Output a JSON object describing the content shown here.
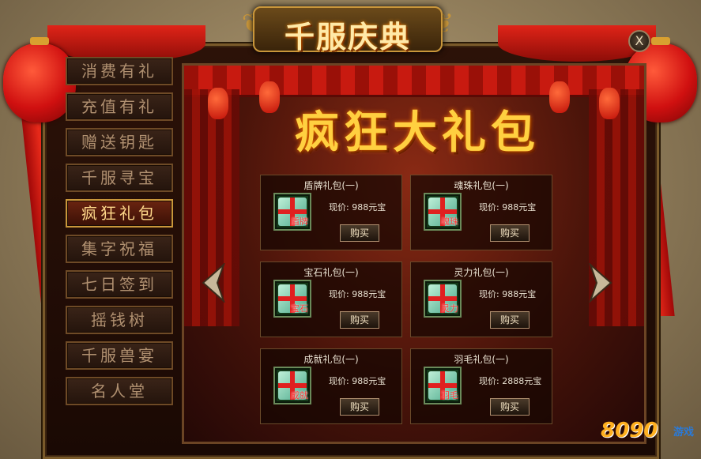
{
  "window": {
    "title": "千服庆典",
    "close_label": "X"
  },
  "sidebar": {
    "items": [
      {
        "label": "消费有礼",
        "active": false
      },
      {
        "label": "充值有礼",
        "active": false
      },
      {
        "label": "赠送钥匙",
        "active": false
      },
      {
        "label": "千服寻宝",
        "active": false
      },
      {
        "label": "疯狂礼包",
        "active": true
      },
      {
        "label": "集字祝福",
        "active": false
      },
      {
        "label": "七日签到",
        "active": false
      },
      {
        "label": "摇钱树",
        "active": false
      },
      {
        "label": "千服兽宴",
        "active": false
      },
      {
        "label": "名人堂",
        "active": false
      }
    ]
  },
  "main": {
    "banner": "疯狂大礼包",
    "packs": [
      {
        "name": "盾牌礼包(一)",
        "tag": "盾牌",
        "price": "现价: 988元宝",
        "buy": "购买"
      },
      {
        "name": "魂珠礼包(一)",
        "tag": "魂珠",
        "price": "现价: 988元宝",
        "buy": "购买"
      },
      {
        "name": "宝石礼包(一)",
        "tag": "宝石",
        "price": "现价: 988元宝",
        "buy": "购买"
      },
      {
        "name": "灵力礼包(一)",
        "tag": "灵力",
        "price": "现价: 988元宝",
        "buy": "购买"
      },
      {
        "name": "成就礼包(一)",
        "tag": "成就",
        "price": "现价: 988元宝",
        "buy": "购买"
      },
      {
        "name": "羽毛礼包(一)",
        "tag": "羽毛",
        "price": "现价: 2888元宝",
        "buy": "购买"
      }
    ]
  },
  "watermark": {
    "main": "8090",
    "sub": "游戏"
  },
  "colors": {
    "accent_gold": "#c9963a",
    "banner_yellow": "#ffd040",
    "curtain_red": "#c81a10"
  },
  "icons": [
    "close-icon",
    "prev-arrow-icon",
    "next-arrow-icon",
    "gift-box-icon",
    "dragon-ornament-icon",
    "lantern-icon"
  ]
}
